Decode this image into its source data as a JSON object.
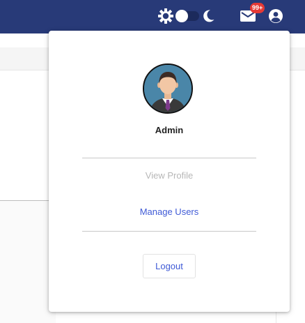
{
  "header": {
    "background_color": "#283a78",
    "icons": {
      "theme_light": "sun-gear-icon",
      "theme_toggle": "toggle-switch",
      "theme_dark": "moon-icon",
      "messages": "mail-icon",
      "account": "account-circle-icon"
    },
    "notification_badge": "99+"
  },
  "user_menu": {
    "avatar_icon": "businessman-avatar",
    "name": "Admin",
    "items": [
      {
        "label": "View Profile",
        "state": "disabled"
      },
      {
        "label": "Manage Users",
        "state": "enabled"
      }
    ],
    "logout_label": "Logout",
    "link_color": "#3f5ad6",
    "disabled_color": "#b7b7b7"
  }
}
